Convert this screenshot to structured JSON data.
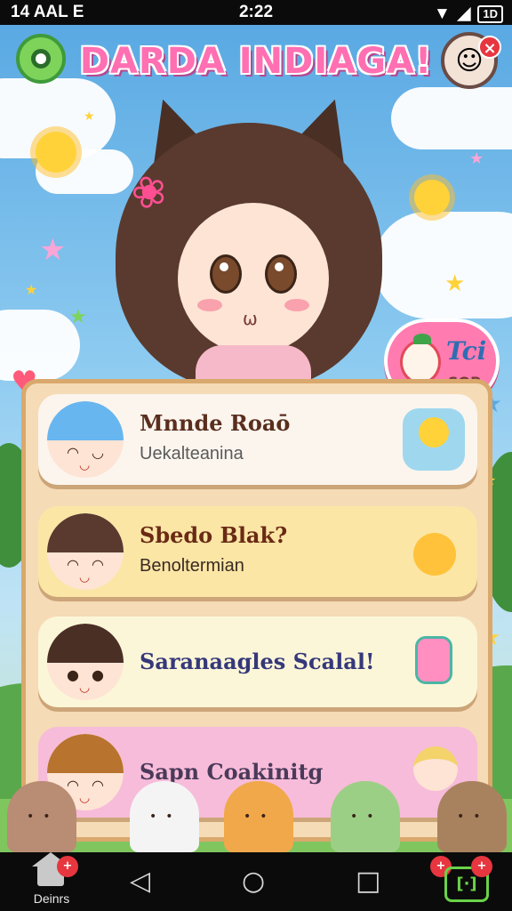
{
  "status_bar": {
    "left": "14 AAL E",
    "time": "2:22",
    "battery": "1D"
  },
  "header": {
    "title": "DARDA INDIAGA!"
  },
  "shop_badge": {
    "line1": "Tci",
    "line2": "SOP"
  },
  "cards": [
    {
      "name": "Mnnde Roaō",
      "sub": "Uekalteanina"
    },
    {
      "name": "Sbedo Blak?",
      "sub": "Benoltermian"
    },
    {
      "name": "Saranaagles Scalal!",
      "sub": ""
    },
    {
      "name": "Sapn Coakinitg",
      "sub": ""
    }
  ],
  "navbar": {
    "home_label": "Deinrs",
    "back_glyph": "◁",
    "home_glyph": "○",
    "recent_glyph": "□",
    "game_glyph": "[·]"
  },
  "colors": {
    "title_pink": "#ff6fb1",
    "panel": "#f5dbb6",
    "panel_border": "#d9a86c",
    "badge_red": "#e7363f"
  }
}
